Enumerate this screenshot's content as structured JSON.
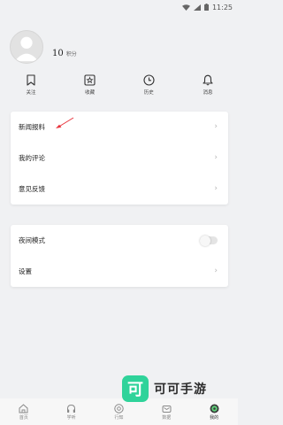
{
  "status_bar": {
    "time": "11:25"
  },
  "profile": {
    "points_value": "10",
    "points_unit": "积分"
  },
  "quick_actions": [
    {
      "label": "关注",
      "icon": "bookmark-icon"
    },
    {
      "label": "收藏",
      "icon": "star-box-icon"
    },
    {
      "label": "历史",
      "icon": "clock-icon"
    },
    {
      "label": "消息",
      "icon": "bell-icon"
    }
  ],
  "menu_group_1": [
    {
      "label": "新闻报料"
    },
    {
      "label": "我的评论"
    },
    {
      "label": "意见反馈"
    }
  ],
  "menu_group_2": {
    "night_mode": {
      "label": "夜间模式",
      "enabled": false
    },
    "settings": {
      "label": "设置"
    }
  },
  "chevron": "›",
  "bottom_nav": [
    {
      "label": "首页",
      "icon": "home-icon",
      "active": false
    },
    {
      "label": "学听",
      "icon": "headphones-icon",
      "active": false
    },
    {
      "label": "行知",
      "icon": "compass-icon",
      "active": false
    },
    {
      "label": "数据",
      "icon": "mail-icon",
      "active": false
    },
    {
      "label": "我的",
      "icon": "profile-icon",
      "active": true
    }
  ],
  "watermark": {
    "logo_char": "可",
    "text": "可可手游"
  },
  "colors": {
    "background": "#f0f1f3",
    "card": "#ffffff",
    "arrow": "#e8333c",
    "watermark": "#2fd39a"
  }
}
